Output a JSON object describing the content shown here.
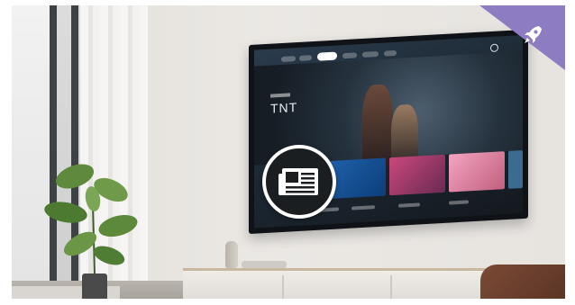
{
  "scene": {
    "colors": {
      "ribbon": "#8e7cc3",
      "badge_ring": "#ffffff",
      "badge_fill": "#1b1e21"
    },
    "icons": {
      "corner": "rocket-icon",
      "overlay": "newspaper-icon"
    }
  },
  "tv": {
    "hero_title": "TNT"
  }
}
